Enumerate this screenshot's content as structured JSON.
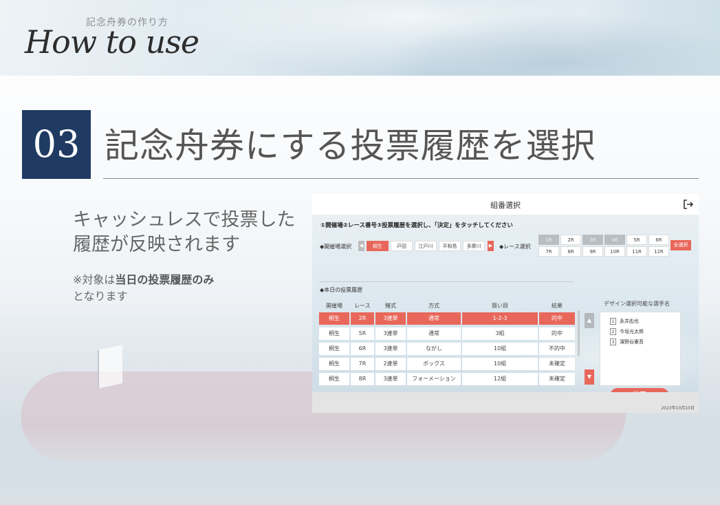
{
  "header": {
    "subtitle": "記念舟券の作り方",
    "script_title": "How to use"
  },
  "step": {
    "number": "03",
    "title": "記念舟券にする投票履歴を選択"
  },
  "description": {
    "line1": "キャッシュレスで投票した",
    "line2": "履歴が反映されます",
    "note_prefix": "※対象は",
    "note_bold": "当日の投票履歴のみ",
    "note_suffix": "となります"
  },
  "app": {
    "title": "組番選択",
    "instruction": "①開催場②レース番号③投票履歴を選択し、「決定」をタッチしてください",
    "venue_label": "◆開催場選択",
    "race_label": "◆レース選択",
    "venues": [
      "桐生",
      "戸田",
      "江戸川",
      "平和島",
      "多摩川"
    ],
    "selected_venue": "桐生",
    "race_buttons": [
      "1R",
      "2R",
      "3R",
      "4R",
      "5R",
      "6R",
      "7R",
      "8R",
      "9R",
      "10R",
      "11R",
      "12R"
    ],
    "disabled_races": [
      "1R",
      "3R",
      "4R"
    ],
    "all_select": "全選択",
    "history_label": "◆本日の投票履歴",
    "table": {
      "headers": [
        "開催場",
        "レース",
        "賭式",
        "方式",
        "買い目",
        "結果"
      ],
      "rows": [
        {
          "venue": "桐生",
          "race": "2R",
          "bet": "3連単",
          "method": "通常",
          "pick": "1-2-3",
          "result": "的中",
          "selected": true
        },
        {
          "venue": "桐生",
          "race": "5R",
          "bet": "3連単",
          "method": "通常",
          "pick": "3組",
          "result": "的中",
          "selected": false
        },
        {
          "venue": "桐生",
          "race": "6R",
          "bet": "3連単",
          "method": "ながし",
          "pick": "10組",
          "result": "不的中",
          "selected": false
        },
        {
          "venue": "桐生",
          "race": "7R",
          "bet": "2連単",
          "method": "ボックス",
          "pick": "10組",
          "result": "未確定",
          "selected": false
        },
        {
          "venue": "桐生",
          "race": "8R",
          "bet": "3連単",
          "method": "フォーメーション",
          "pick": "12組",
          "result": "未確定",
          "selected": false
        }
      ]
    },
    "racer_label": "デザイン選択可能な選手名",
    "racers": [
      {
        "no": "1",
        "name": "永井彪也"
      },
      {
        "no": "2",
        "name": "今垣光太郎"
      },
      {
        "no": "3",
        "name": "濱野谷憲吾"
      }
    ],
    "decide": "決定",
    "date": "2023年10月10日",
    "colors": {
      "accent": "#e8675a",
      "navy": "#1f3b63"
    }
  }
}
